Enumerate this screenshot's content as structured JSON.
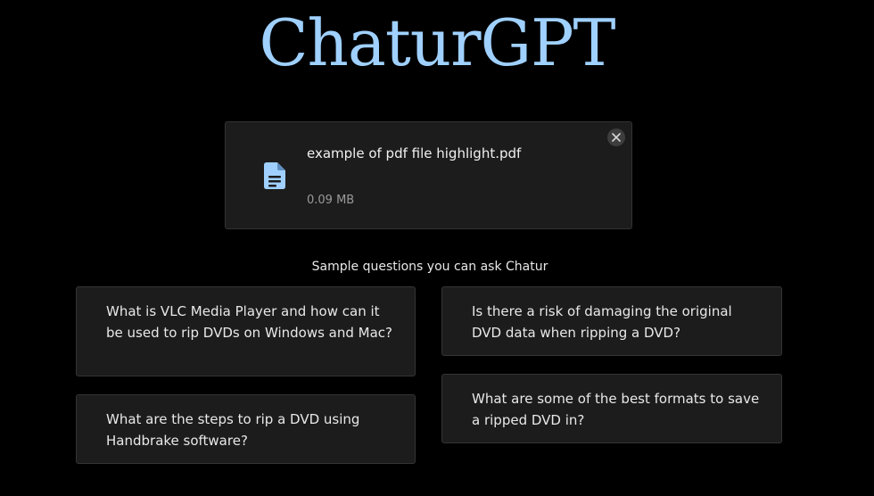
{
  "app": {
    "title": "ChaturGPT"
  },
  "file": {
    "name": "example of pdf file highlight.pdf",
    "size": "0.09 MB",
    "icon": "document-icon",
    "close_icon": "close-icon"
  },
  "samples": {
    "label": "Sample questions you can ask Chatur",
    "questions": [
      "What is VLC Media Player and how can it be used to rip DVDs on Windows and Mac?",
      "Is there a risk of damaging the original DVD data when ripping a DVD?",
      "What are the steps to rip a DVD using Handbrake software?",
      "What are some of the best formats to save a ripped DVD in?"
    ]
  },
  "colors": {
    "background": "#000000",
    "title": "#9fd0ff",
    "card": "#1c1c1c",
    "icon": "#9fd0ff"
  }
}
